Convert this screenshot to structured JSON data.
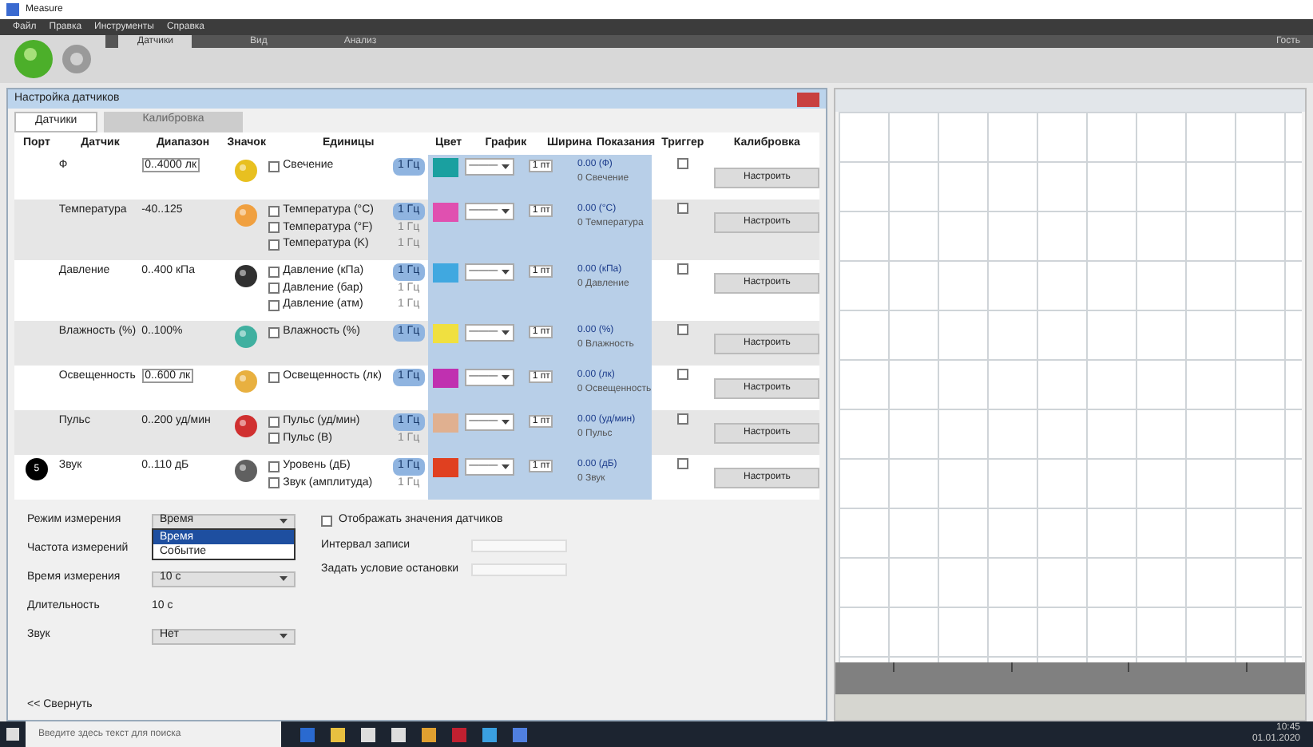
{
  "app": {
    "title": "Measure",
    "menu": [
      "Файл",
      "Правка",
      "Инструменты",
      "Справка"
    ],
    "ribbon_tabs": [
      {
        "label": "Датчики",
        "selected": true
      },
      {
        "label": "Вид",
        "selected": false
      },
      {
        "label": "Анализ",
        "selected": false
      }
    ],
    "user": "Гость"
  },
  "dialog": {
    "title": "Настройка датчиков",
    "tabs": [
      {
        "label": "Датчики",
        "selected": true
      },
      {
        "label": "Калибровка",
        "selected": false
      }
    ],
    "columns": [
      "Порт",
      "Датчик",
      "Диапазон",
      "Значок",
      "Единицы",
      "Цвет",
      "График",
      "Ширина",
      "Показания",
      "Триггер",
      "Калибровка"
    ],
    "rows": [
      {
        "port": "",
        "sensor": "Ф",
        "range": "0..4000 лк",
        "range_dropdown": true,
        "icon": {
          "color": "#e8c020"
        },
        "units": [
          {
            "label": "Свечение",
            "checked": false,
            "rate": "1 Гц",
            "selected": true
          }
        ],
        "trace": {
          "color": "#1aa0a0"
        },
        "line": "———",
        "width": "1 пт",
        "reading": "0.00 (Ф)",
        "reading_2": "0 Свечение",
        "trigger": false,
        "calibrate": "Настроить",
        "shaded": false
      },
      {
        "port": "",
        "sensor": "Температура",
        "range": "-40..125",
        "range_dropdown": false,
        "icon": {
          "color": "#f0a040"
        },
        "units": [
          {
            "label": "Температура (°C)",
            "checked": false,
            "rate": "1 Гц",
            "selected": true
          },
          {
            "label": "Температура (°F)",
            "checked": false,
            "rate": "1 Гц",
            "selected": false
          },
          {
            "label": "Температура (K)",
            "checked": false,
            "rate": "1 Гц",
            "selected": false
          }
        ],
        "trace": {
          "color": "#e050b0"
        },
        "line": "———",
        "width": "1 пт",
        "reading": "0.00 (°C)",
        "reading_2": "0 Температура",
        "trigger": false,
        "calibrate": "Настроить",
        "shaded": true
      },
      {
        "port": "",
        "sensor": "Давление",
        "range": "0..400 кПа",
        "range_dropdown": false,
        "icon": {
          "color": "#303030"
        },
        "units": [
          {
            "label": "Давление (кПа)",
            "checked": false,
            "rate": "1 Гц",
            "selected": true
          },
          {
            "label": "Давление (бар)",
            "checked": false,
            "rate": "1 Гц",
            "selected": false
          },
          {
            "label": "Давление (атм)",
            "checked": false,
            "rate": "1 Гц",
            "selected": false
          }
        ],
        "trace": {
          "color": "#40a8e0"
        },
        "line": "———",
        "width": "1 пт",
        "reading": "0.00 (кПа)",
        "reading_2": "0 Давление",
        "trigger": false,
        "calibrate": "Настроить",
        "shaded": false
      },
      {
        "port": "",
        "sensor": "Влажность (%)",
        "range": "0..100%",
        "range_dropdown": false,
        "icon": {
          "color": "#40b0a0"
        },
        "units": [
          {
            "label": "Влажность (%)",
            "checked": false,
            "rate": "1 Гц",
            "selected": true
          }
        ],
        "trace": {
          "color": "#f0e040"
        },
        "line": "———",
        "width": "1 пт",
        "reading": "0.00 (%)",
        "reading_2": "0 Влажность",
        "trigger": false,
        "calibrate": "Настроить",
        "shaded": true
      },
      {
        "port": "",
        "sensor": "Освещенность",
        "range": "0..600 лк",
        "range_dropdown": true,
        "icon": {
          "color": "#e8b040"
        },
        "units": [
          {
            "label": "Освещенность (лк)",
            "checked": false,
            "rate": "1 Гц",
            "selected": true
          }
        ],
        "trace": {
          "color": "#c030b0"
        },
        "line": "———",
        "width": "1 пт",
        "reading": "0.00 (лк)",
        "reading_2": "0 Освещенность",
        "trigger": false,
        "calibrate": "Настроить",
        "shaded": false
      },
      {
        "port": "",
        "sensor": "Пульс",
        "range": "0..200 уд/мин",
        "range_dropdown": false,
        "icon": {
          "color": "#d03030"
        },
        "units": [
          {
            "label": "Пульс (уд/мин)",
            "checked": false,
            "rate": "1 Гц",
            "selected": true
          },
          {
            "label": "Пульс (В)",
            "checked": false,
            "rate": "1 Гц",
            "selected": false
          }
        ],
        "trace": {
          "color": "#e0b090"
        },
        "line": "———",
        "width": "1 пт",
        "reading": "0.00 (уд/мин)",
        "reading_2": "0 Пульс",
        "trigger": false,
        "calibrate": "Настроить",
        "shaded": true
      },
      {
        "port": "5",
        "sensor": "Звук",
        "range": "0..110 дБ",
        "range_dropdown": false,
        "icon": {
          "color": "#606060"
        },
        "units": [
          {
            "label": "Уровень (дБ)",
            "checked": false,
            "rate": "1 Гц",
            "selected": true
          },
          {
            "label": "Звук (амплитуда)",
            "checked": false,
            "rate": "1 Гц",
            "selected": false
          }
        ],
        "trace": {
          "color": "#e04020"
        },
        "line": "———",
        "width": "1 пт",
        "reading": "0.00 (дБ)",
        "reading_2": "0 Звук",
        "trigger": false,
        "calibrate": "Настроить",
        "shaded": false
      }
    ],
    "settings": [
      {
        "label": "Режим измерения",
        "value": "Время",
        "options": [
          {
            "label": "Время",
            "selected": true
          },
          {
            "label": "Событие",
            "selected": false
          }
        ]
      },
      {
        "label": "Частота измерений"
      },
      {
        "label": "Время измерения",
        "value": "10 с"
      },
      {
        "label": "Длительность",
        "value": "10 с",
        "kind": "text"
      },
      {
        "label": "Звук",
        "value": "Нет"
      }
    ],
    "options": [
      {
        "label": "Отображать значения датчиков",
        "kind": "checkbox",
        "checked": false
      },
      {
        "label": "Интервал записи",
        "kind": "field"
      },
      {
        "label": "Задать условие остановки",
        "kind": "field"
      }
    ],
    "collapse": "<< Свернуть"
  },
  "taskbar": {
    "search": {
      "placeholder": "Введите здесь текст для поиска"
    },
    "time": "10:45",
    "date": "01.01.2020"
  }
}
